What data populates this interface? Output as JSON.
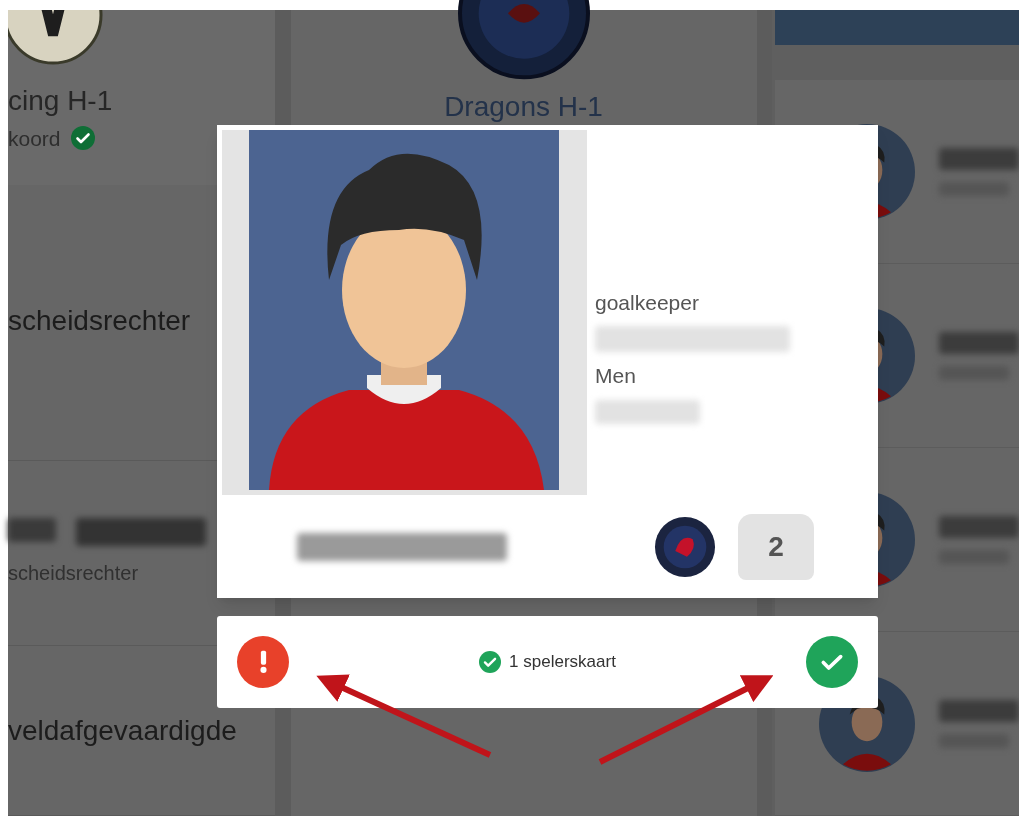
{
  "left_panel": {
    "team": {
      "name": "cing H-1",
      "status": "koord",
      "confirmed": true
    },
    "rows": [
      {
        "kind": "role",
        "text": "scheidsrechter"
      },
      {
        "kind": "person",
        "text": "scheidsrechter"
      },
      {
        "kind": "role",
        "text": "veldafgevaardigde"
      }
    ]
  },
  "center_panel": {
    "team": {
      "name": "Dragons H-1"
    }
  },
  "player_modal": {
    "position": "goalkeeper",
    "category": "Men",
    "shirt_number": "2"
  },
  "modal_footer": {
    "cards_text": "1 spelerskaart",
    "cards_valid": true
  }
}
